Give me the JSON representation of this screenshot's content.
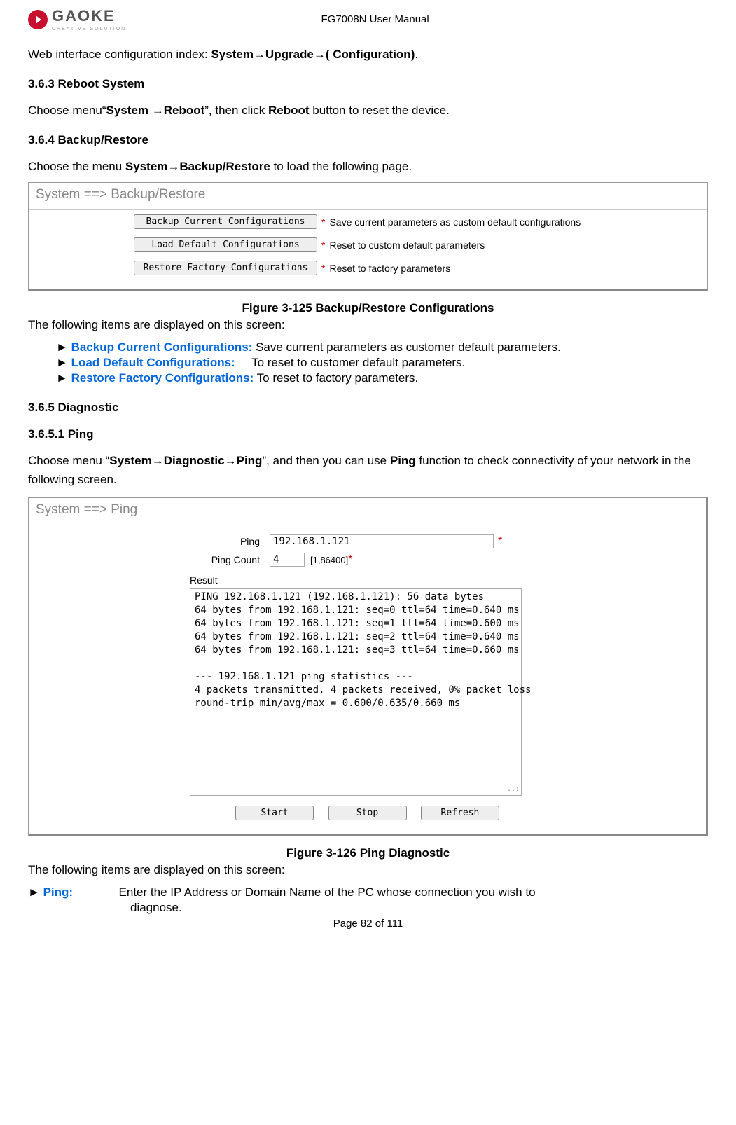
{
  "header": {
    "logo_text": "GAOKE",
    "logo_sub": "CREATIVE SOLUTION",
    "doc_title": "FG7008N User Manual"
  },
  "intro": {
    "prefix": "Web interface configuration index: ",
    "path": "System→Upgrade→( Configuration)",
    "suffix": "."
  },
  "s363": {
    "heading": "3.6.3    Reboot System",
    "line_prefix": "Choose menu“",
    "bold1": "System →Reboot",
    "mid": "”, then click ",
    "bold2": "Reboot",
    "suffix": " button to reset the device."
  },
  "s364": {
    "heading": "3.6.4    Backup/Restore",
    "line_prefix": "Choose the menu ",
    "bold1": "System→Backup/Restore",
    "suffix": " to load the following page."
  },
  "backup_ui": {
    "breadcrumb": "System ==> Backup/Restore",
    "rows": [
      {
        "btn": "Backup Current Configurations",
        "desc": "Save current parameters as custom default configurations"
      },
      {
        "btn": "Load Default Configurations",
        "desc": "Reset to custom default parameters"
      },
      {
        "btn": "Restore Factory Configurations",
        "desc": "Reset to factory parameters"
      }
    ]
  },
  "fig125": "Figure 3-125  Backup/Restore Configurations",
  "after_fig125": "The following items are displayed on this screen:",
  "bullets": [
    {
      "label": "Backup Current Configurations:",
      "desc": " Save current parameters as customer default parameters."
    },
    {
      "label": "Load Default Configurations:",
      "desc": "     To reset to customer default parameters."
    },
    {
      "label": "Restore Factory Configurations:",
      "desc": " To reset to factory parameters."
    }
  ],
  "s365": {
    "heading": "3.6.5    Diagnostic"
  },
  "s3651": {
    "heading": "3.6.5.1      Ping",
    "line_prefix": "Choose menu “",
    "bold1": "System→Diagnostic→Ping",
    "mid": "”, and then you can use ",
    "bold2": "Ping",
    "suffix": " function to check connectivity of your network in the following screen."
  },
  "ping_ui": {
    "breadcrumb": "System ==> Ping",
    "ping_label": "Ping",
    "ping_value": "192.168.1.121",
    "count_label": "Ping Count",
    "count_value": "4",
    "count_hint": "[1,86400]",
    "result_label": "Result",
    "result_text": "PING 192.168.1.121 (192.168.1.121): 56 data bytes\n64 bytes from 192.168.1.121: seq=0 ttl=64 time=0.640 ms\n64 bytes from 192.168.1.121: seq=1 ttl=64 time=0.600 ms\n64 bytes from 192.168.1.121: seq=2 ttl=64 time=0.640 ms\n64 bytes from 192.168.1.121: seq=3 ttl=64 time=0.660 ms\n\n--- 192.168.1.121 ping statistics ---\n4 packets transmitted, 4 packets received, 0% packet loss\nround-trip min/avg/max = 0.600/0.635/0.660 ms",
    "btn_start": "Start",
    "btn_stop": "Stop",
    "btn_refresh": "Refresh"
  },
  "fig126": "Figure 3-126  Ping Diagnostic",
  "after_fig126": "The following items are displayed on this screen:",
  "ping_item": {
    "label": "Ping:",
    "desc1": "Enter the IP Address or Domain Name of the PC whose connection you wish to",
    "desc2": "diagnose."
  },
  "footer": "Page 82 of 111"
}
